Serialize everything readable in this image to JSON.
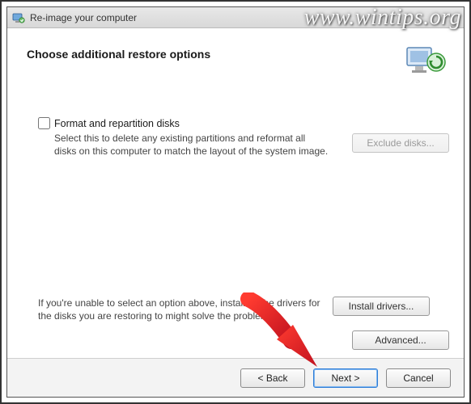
{
  "window": {
    "title": "Re-image your computer"
  },
  "header": {
    "heading": "Choose additional restore options"
  },
  "format": {
    "checkbox_label": "Format and repartition disks",
    "description": "Select this to delete any existing partitions and reformat all disks on this computer to match the layout of the system image.",
    "exclude_button": "Exclude disks..."
  },
  "drivers": {
    "description": "If you're unable to select an option above, installing the drivers for the disks you are restoring to might solve the problem.",
    "install_button": "Install drivers...",
    "advanced_button": "Advanced..."
  },
  "footer": {
    "back": "< Back",
    "next": "Next >",
    "cancel": "Cancel"
  },
  "watermark": "www.wintips.org"
}
